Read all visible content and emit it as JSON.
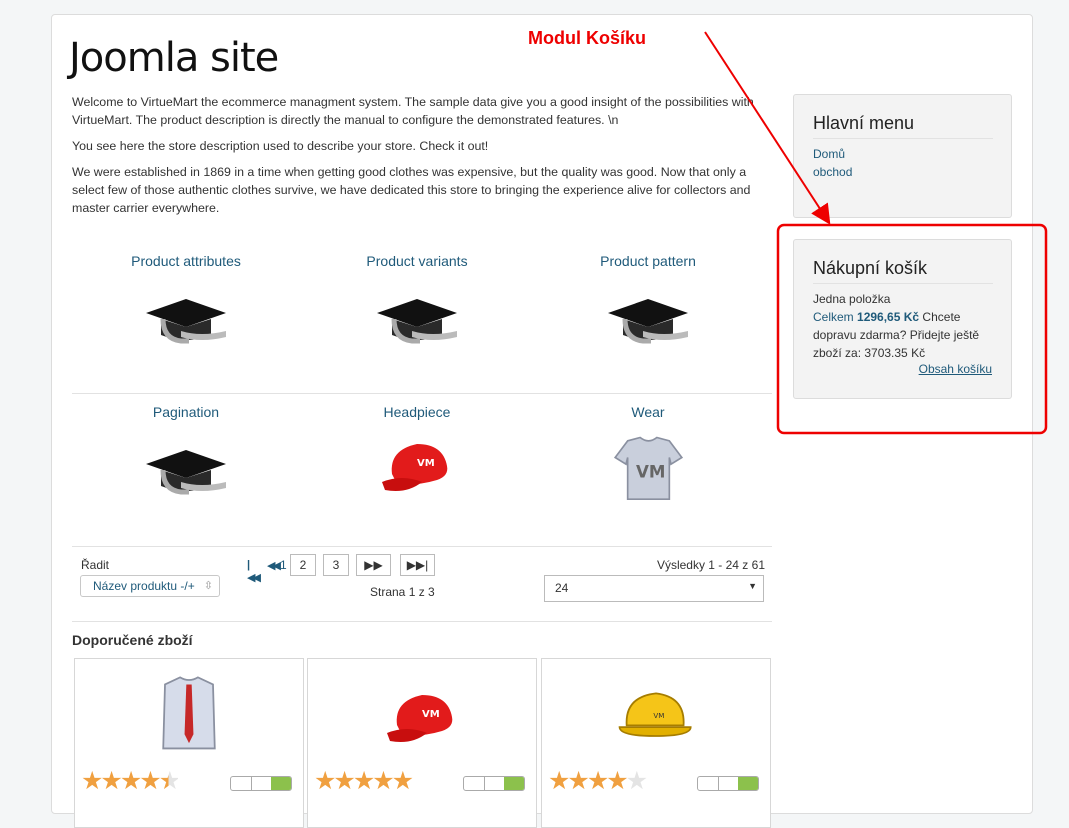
{
  "site_title": "Joomla site",
  "intro": {
    "p1": "Welcome to VirtueMart the ecommerce managment system. The sample data give you a good insight of the possibilities with VirtueMart. The product description is directly the manual to configure the demonstrated features. \\n",
    "p2": "You see here the store description used to describe your store. Check it out!",
    "p3": "We were established in 1869 in a time when getting good clothes was expensive, but the quality was good. Now that only a select few of those authentic clothes survive, we have dedicated this store to bringing the experience alive for collectors and master carrier everywhere."
  },
  "categories": [
    {
      "label": "Product attributes",
      "icon": "graduation-cap-icon"
    },
    {
      "label": "Product variants",
      "icon": "graduation-cap-icon"
    },
    {
      "label": "Product pattern",
      "icon": "graduation-cap-icon"
    },
    {
      "label": "Pagination",
      "icon": "graduation-cap-icon"
    },
    {
      "label": "Headpiece",
      "icon": "red-cap-icon"
    },
    {
      "label": "Wear",
      "icon": "tshirt-icon"
    }
  ],
  "toolbar": {
    "sort_label": "Řadit",
    "sort_button": "Název produktu -/+",
    "pager": {
      "current": "1",
      "pages": [
        "2",
        "3"
      ],
      "status": "Strana 1 z 3"
    },
    "results": "Výsledky 1 - 24 z 61",
    "limit_value": "24"
  },
  "featured": {
    "title": "Doporučené zboží",
    "items": [
      {
        "icon": "shirt-tie-icon",
        "rating": 4.5
      },
      {
        "icon": "red-cap-icon",
        "rating": 5
      },
      {
        "icon": "hard-hat-icon",
        "rating": 4
      }
    ]
  },
  "sidebar": {
    "menu": {
      "title": "Hlavní menu",
      "items": [
        "Domů",
        "obchod"
      ]
    },
    "cart": {
      "title": "Nákupní košík",
      "line1": "Jedna položka",
      "total_label": "Celkem",
      "total_value": "1296,65 Kč",
      "shipping_text": " Chcete dopravu zdarma? Přidejte ještě zboží za: 3703.35 Kč",
      "link": "Obsah košíku"
    }
  },
  "annotation": {
    "label": "Modul Košíku",
    "color": "#e00000"
  }
}
